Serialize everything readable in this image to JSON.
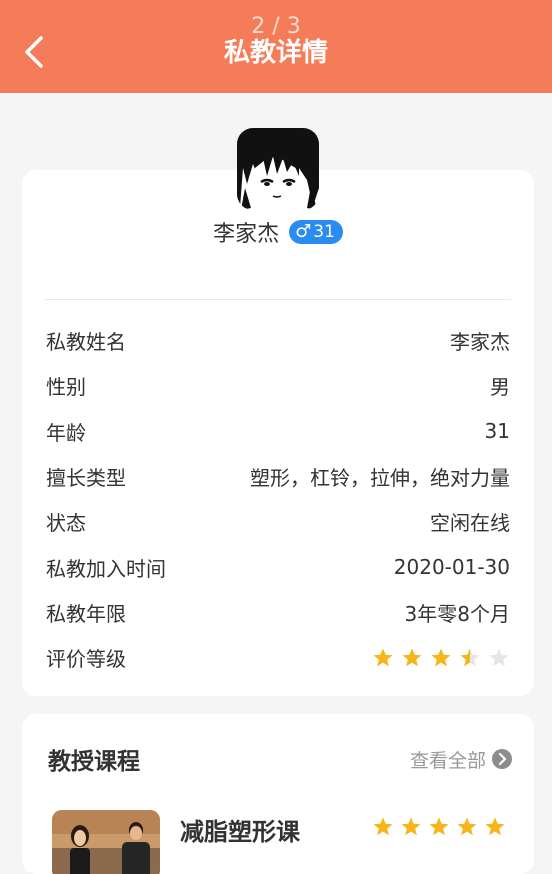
{
  "header": {
    "pager": "2 / 3",
    "title": "私教详情",
    "background": "#f47c58"
  },
  "profile": {
    "avatar_icon": "anime-boy-avatar",
    "name": "李家杰",
    "gender_symbol": "♂",
    "age_badge": "31",
    "badge_color": "#2a8cf0"
  },
  "info": [
    {
      "label": "私教姓名",
      "value": "李家杰"
    },
    {
      "label": "性别",
      "value": "男"
    },
    {
      "label": "年龄",
      "value": "31"
    },
    {
      "label": "擅长类型",
      "value": "塑形，杠铃，拉伸，绝对力量"
    },
    {
      "label": "状态",
      "value": "空闲在线"
    },
    {
      "label": "私教加入时间",
      "value": "2020-01-30"
    },
    {
      "label": "私教年限",
      "value": "3年零8个月"
    },
    {
      "label": "评价等级",
      "rating": 3.5,
      "rating_max": 5
    }
  ],
  "courses": {
    "title": "教授课程",
    "view_all": "查看全部",
    "items": [
      {
        "name": "减脂塑形课",
        "rating": 5,
        "rating_max": 5
      }
    ]
  },
  "colors": {
    "star_filled": "#f7b51c",
    "star_empty": "#e6e6e6"
  }
}
